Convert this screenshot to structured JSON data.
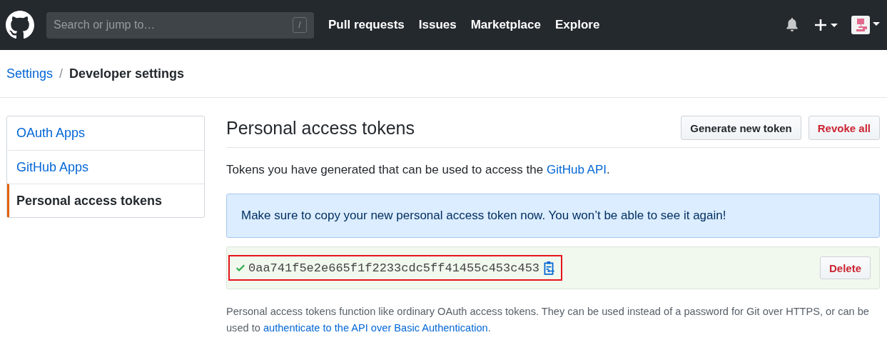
{
  "header": {
    "search": {
      "placeholder": "Search or jump to…",
      "shortcut": "/"
    },
    "nav": [
      "Pull requests",
      "Issues",
      "Marketplace",
      "Explore"
    ]
  },
  "breadcrumb": {
    "parent": "Settings",
    "separator": "/",
    "current": "Developer settings"
  },
  "sidebar": {
    "items": [
      {
        "label": "OAuth Apps",
        "selected": false
      },
      {
        "label": "GitHub Apps",
        "selected": false
      },
      {
        "label": "Personal access tokens",
        "selected": true
      }
    ]
  },
  "main": {
    "title": "Personal access tokens",
    "buttons": [
      {
        "label": "Generate new token",
        "kind": "default"
      },
      {
        "label": "Revoke all",
        "kind": "danger"
      }
    ],
    "intro": {
      "text": "Tokens you have generated that can be used to access the ",
      "link": "GitHub API",
      "after": "."
    },
    "flash": "Make sure to copy your new personal access token now. You won’t be able to see it again!",
    "token": {
      "value": "0aa741f5e2e665f1f2233cdc5ff41455c453c453",
      "highlighted": true,
      "delete_label": "Delete"
    },
    "note": {
      "text": "Personal access tokens function like ordinary OAuth access tokens. They can be used instead of a password for Git over HTTPS, or can be used to ",
      "link": "authenticate to the API over Basic Authentication",
      "after": "."
    }
  }
}
